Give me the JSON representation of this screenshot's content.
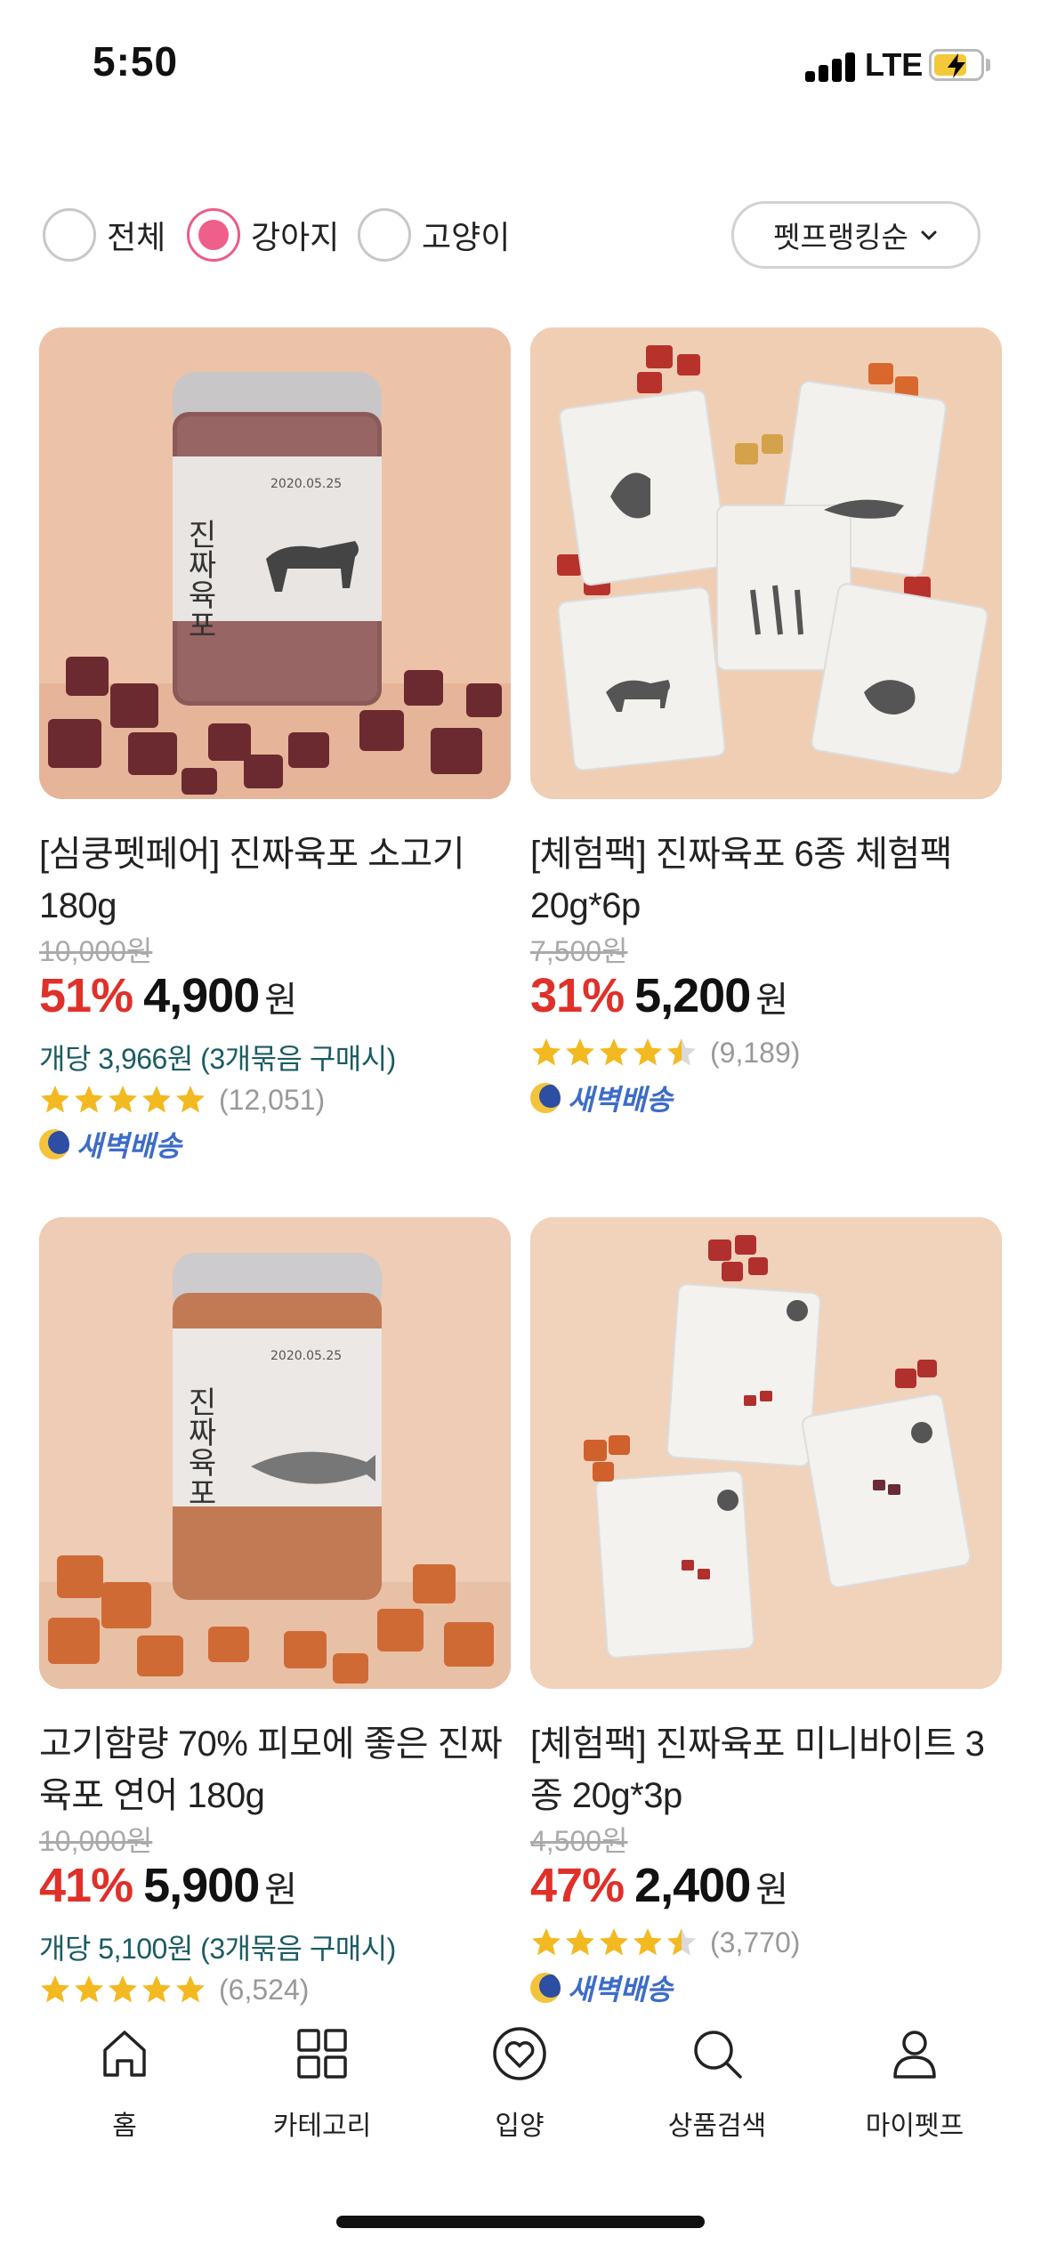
{
  "status_bar": {
    "time": "5:50",
    "carrier": "LTE"
  },
  "filters": {
    "options": [
      {
        "label": "전체",
        "selected": false
      },
      {
        "label": "강아지",
        "selected": true
      },
      {
        "label": "고양이",
        "selected": false
      }
    ],
    "sort_label": "펫프랭킹순"
  },
  "products": [
    {
      "title": "[심쿵펫페어] 진짜육포 소고기 180g",
      "original_price": "10,000원",
      "discount": "51%",
      "price": "4,900",
      "currency": "원",
      "per_unit": "개당 3,966원 (3개묶음 구매시)",
      "rating": 5,
      "review_count": "(12,051)",
      "dawn_delivery": "새벽배송"
    },
    {
      "title": "[체험팩] 진짜육포 6종 체험팩 20g*6p",
      "original_price": "7,500원",
      "discount": "31%",
      "price": "5,200",
      "currency": "원",
      "per_unit": "",
      "rating": 4.5,
      "review_count": "(9,189)",
      "dawn_delivery": "새벽배송"
    },
    {
      "title": "고기함량 70% 피모에 좋은 진짜육포 연어 180g",
      "original_price": "10,000원",
      "discount": "41%",
      "price": "5,900",
      "currency": "원",
      "per_unit": "개당 5,100원 (3개묶음 구매시)",
      "rating": 5,
      "review_count": "(6,524)",
      "dawn_delivery": ""
    },
    {
      "title": "[체험팩] 진짜육포 미니바이트 3종 20g*3p",
      "original_price": "4,500원",
      "discount": "47%",
      "price": "2,400",
      "currency": "원",
      "per_unit": "",
      "rating": 4.5,
      "review_count": "(3,770)",
      "dawn_delivery": "새벽배송"
    }
  ],
  "product_images": {
    "jar_label_text": "진짜육포",
    "jar_date_text": "2020.05.25"
  },
  "bottom_nav": [
    {
      "label": "홈",
      "icon": "home-icon"
    },
    {
      "label": "카테고리",
      "icon": "grid-icon"
    },
    {
      "label": "입양",
      "icon": "heart-icon"
    },
    {
      "label": "상품검색",
      "icon": "search-icon"
    },
    {
      "label": "마이펫프",
      "icon": "person-icon"
    }
  ],
  "colors": {
    "accent_pink": "#ef5f8b",
    "discount_red": "#e0302a",
    "per_unit_teal": "#1a5c63",
    "star_yellow": "#f2b920",
    "dawn_blue": "#3d6cc8"
  }
}
